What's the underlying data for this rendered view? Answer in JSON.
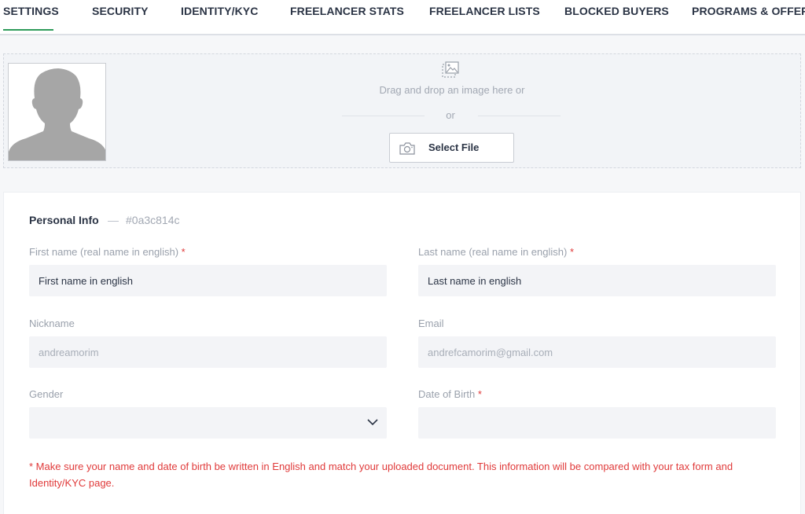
{
  "tabs": [
    {
      "label": "SETTINGS",
      "active": true
    },
    {
      "label": "SECURITY"
    },
    {
      "label": "IDENTITY/KYC"
    },
    {
      "label": "FREELANCER STATS"
    },
    {
      "label": "FREELANCER LISTS"
    },
    {
      "label": "BLOCKED BUYERS"
    },
    {
      "label": "PROGRAMS & OFFERS"
    }
  ],
  "upload": {
    "drag_text": "Drag and drop an image here or",
    "or_text": "or",
    "select_button": "Select File"
  },
  "personal_info": {
    "title": "Personal Info",
    "dash": "—",
    "id": "#0a3c814c",
    "first_name": {
      "label": "First name (real name in english)",
      "required": "*",
      "placeholder": "First name in english"
    },
    "last_name": {
      "label": "Last name (real name in english)",
      "required": "*",
      "placeholder": "Last name in english"
    },
    "nickname": {
      "label": "Nickname",
      "value": "andreamorim"
    },
    "email": {
      "label": "Email",
      "value": "andrefcamorim@gmail.com"
    },
    "gender": {
      "label": "Gender",
      "value": ""
    },
    "dob": {
      "label": "Date of Birth",
      "required": "*",
      "value": ""
    },
    "note": "* Make sure your name and date of birth be written in English and match your uploaded document. This information will be compared with your tax form and Identity/KYC page."
  },
  "colors": {
    "accent": "#2e9b5a",
    "required": "#e03a3a",
    "input_bg": "#f3f4f7"
  }
}
